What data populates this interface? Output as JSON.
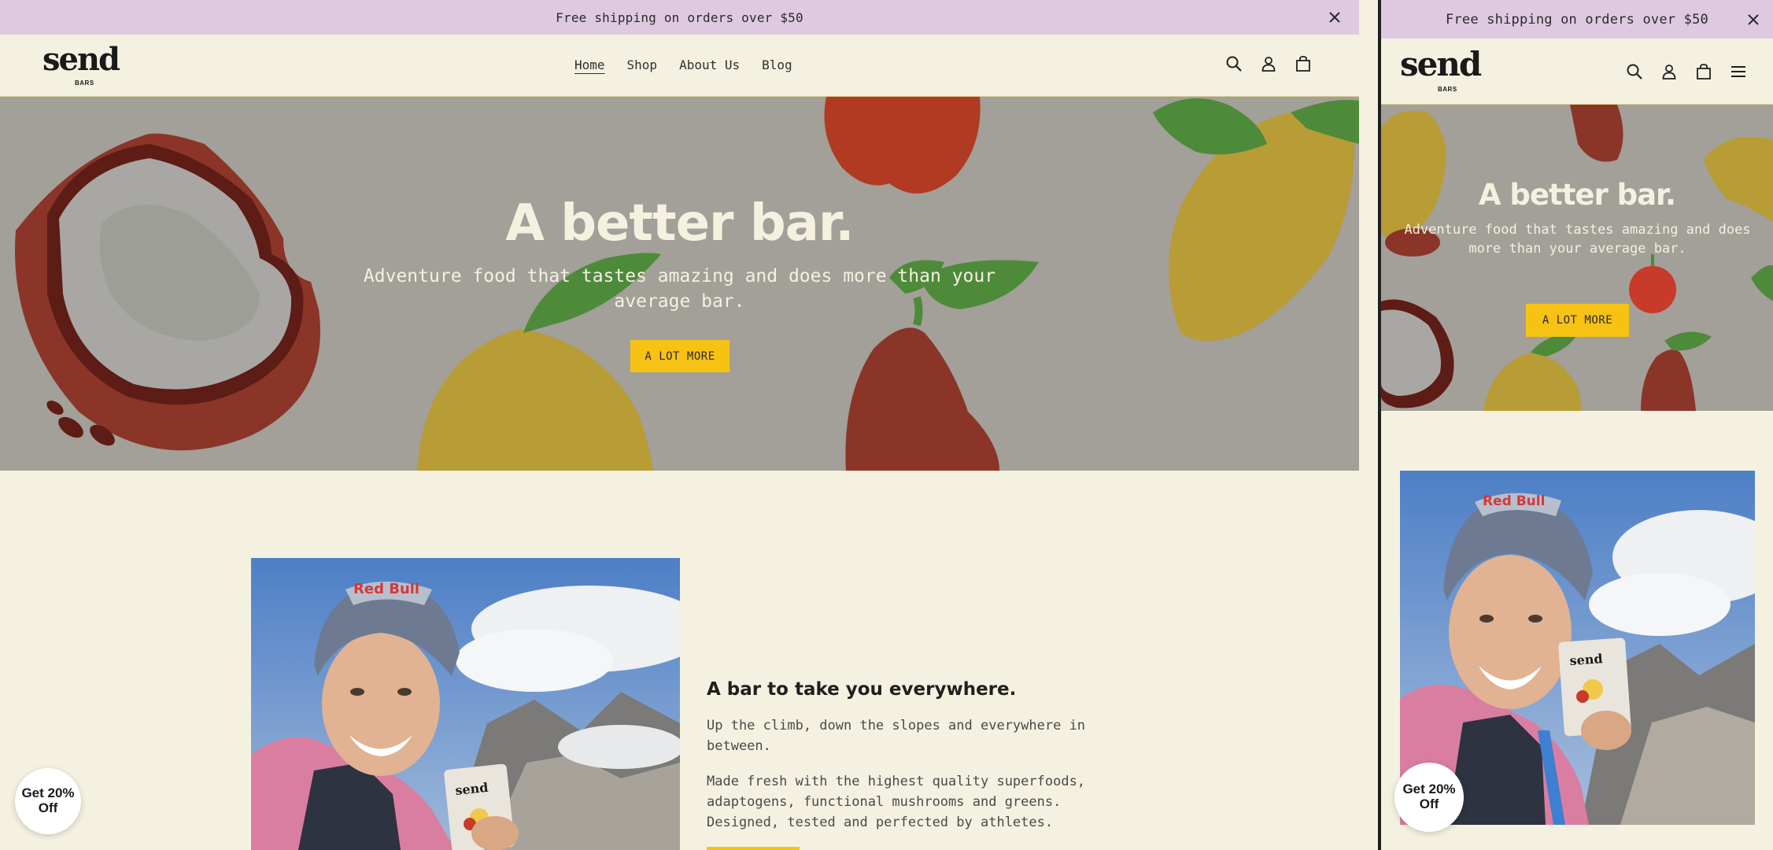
{
  "announcement": {
    "text": "Free shipping on orders over $50"
  },
  "brand": {
    "name": "send",
    "sub": "BARS"
  },
  "nav": {
    "items": [
      "Home",
      "Shop",
      "About Us",
      "Blog"
    ],
    "active": "Home"
  },
  "hero": {
    "title": "A better bar.",
    "subtitle": "Adventure food that tastes amazing and does more than your average bar.",
    "cta": "A LOT MORE"
  },
  "feature": {
    "title": "A bar to take you everywhere.",
    "p1": "Up the climb, down the slopes and everywhere in between.",
    "p2": "Made fresh with the highest quality superfoods, adaptogens, functional mushrooms and greens. Designed, tested and perfected by athletes."
  },
  "discount": {
    "line1": "Get 20%",
    "line2": "Off"
  },
  "photo": {
    "helmet_text": "Red Bull",
    "pouch_text": "send"
  },
  "colors": {
    "announce_bg": "#dfc9e1",
    "page_bg": "#f4f1e0",
    "hero_bg": "#a39f99",
    "cta": "#f6c214"
  },
  "icons": [
    "close-icon",
    "search-icon",
    "account-icon",
    "cart-icon",
    "menu-icon"
  ]
}
